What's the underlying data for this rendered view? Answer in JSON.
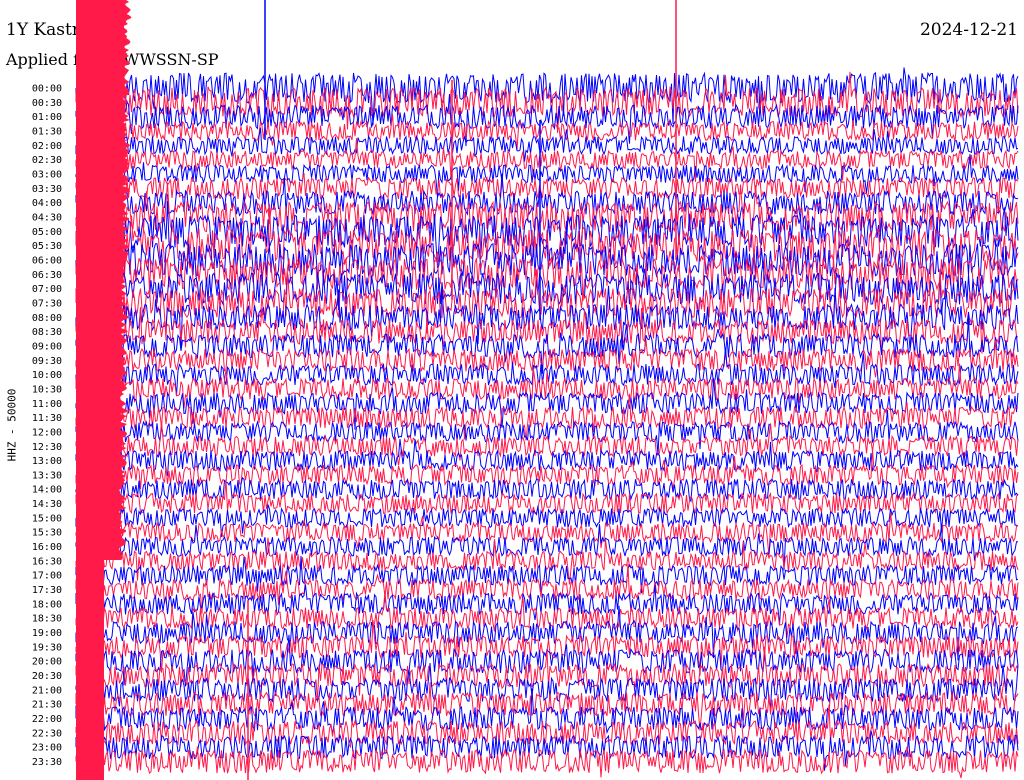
{
  "header": {
    "station": "1Y Kastr",
    "date": "2024-12-21",
    "filter": "Applied filter: WWSSN-SP"
  },
  "chart_data": {
    "type": "line",
    "title": "1Y Kastr",
    "date": "2024-12-21",
    "ylabel": "HHZ - 50000",
    "rows": [
      "00:00",
      "00:30",
      "01:00",
      "01:30",
      "02:00",
      "02:30",
      "03:00",
      "03:30",
      "04:00",
      "04:30",
      "05:00",
      "05:30",
      "06:00",
      "06:30",
      "07:00",
      "07:30",
      "08:00",
      "08:30",
      "09:00",
      "09:30",
      "10:00",
      "10:30",
      "11:00",
      "11:30",
      "12:00",
      "12:30",
      "13:00",
      "13:30",
      "14:00",
      "14:30",
      "15:00",
      "15:30",
      "16:00",
      "16:30",
      "17:00",
      "17:30",
      "18:00",
      "18:30",
      "19:00",
      "19:30",
      "20:00",
      "20:30",
      "21:00",
      "21:30",
      "22:00",
      "22:30",
      "23:00",
      "23:30"
    ],
    "trace_colors": [
      "#0000ff",
      "#ff1a4a"
    ],
    "activity_level": [
      0.9,
      0.85,
      0.6,
      0.4,
      0.35,
      0.35,
      0.35,
      0.5,
      0.6,
      0.9,
      1.0,
      1.0,
      1.0,
      1.0,
      0.95,
      0.85,
      0.7,
      0.65,
      0.6,
      0.55,
      0.5,
      0.5,
      0.5,
      0.5,
      0.45,
      0.45,
      0.45,
      0.45,
      0.45,
      0.45,
      0.4,
      0.4,
      0.4,
      0.4,
      0.45,
      0.45,
      0.5,
      0.5,
      0.55,
      0.55,
      0.6,
      0.6,
      0.6,
      0.6,
      0.6,
      0.6,
      0.6,
      0.6
    ],
    "grid": false
  }
}
